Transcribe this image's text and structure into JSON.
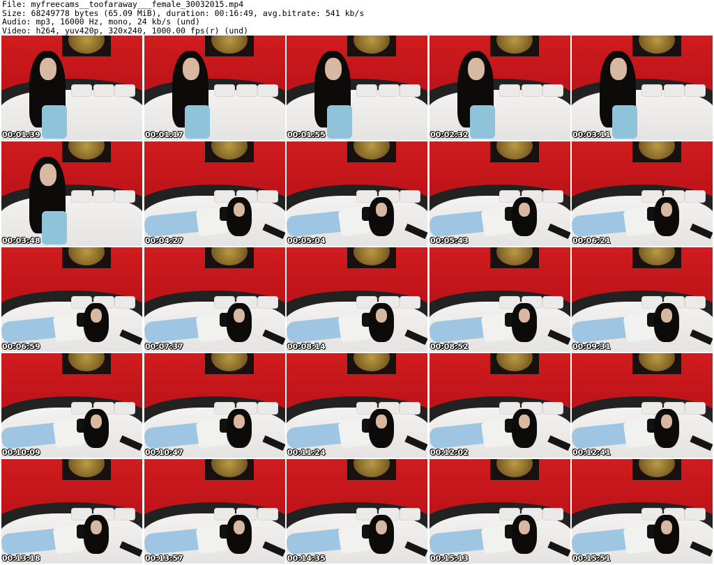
{
  "header": {
    "line1": "File: myfreecams__toofaraway___female_30032015.mp4",
    "line2": "Size: 68249778 bytes (65.09 MiB), duration: 00:16:49, avg.bitrate: 541 kb/s",
    "line3": "Audio: mp3, 16000 Hz, mono, 24 kb/s (und)",
    "line4": "Video: h264, yuv420p, 320x240, 1000.00 fps(r) (und)"
  },
  "thumbnails": [
    {
      "time": "00:01:39",
      "pose": "sit"
    },
    {
      "time": "00:01:17",
      "pose": "sit"
    },
    {
      "time": "00:01:55",
      "pose": "sit"
    },
    {
      "time": "00:02:32",
      "pose": "sit"
    },
    {
      "time": "00:03:11",
      "pose": "sit"
    },
    {
      "time": "00:03:48",
      "pose": "sit"
    },
    {
      "time": "00:04:27",
      "pose": "lie"
    },
    {
      "time": "00:05:04",
      "pose": "lie"
    },
    {
      "time": "00:05:43",
      "pose": "lie"
    },
    {
      "time": "00:06:21",
      "pose": "lie"
    },
    {
      "time": "00:06:59",
      "pose": "lie"
    },
    {
      "time": "00:07:37",
      "pose": "lie"
    },
    {
      "time": "00:08:14",
      "pose": "lie"
    },
    {
      "time": "00:08:52",
      "pose": "lie"
    },
    {
      "time": "00:09:31",
      "pose": "lie"
    },
    {
      "time": "00:10:09",
      "pose": "lie"
    },
    {
      "time": "00:10:47",
      "pose": "lie"
    },
    {
      "time": "00:11:24",
      "pose": "lie"
    },
    {
      "time": "00:12:02",
      "pose": "lie"
    },
    {
      "time": "00:12:41",
      "pose": "lie"
    },
    {
      "time": "00:13:18",
      "pose": "lie"
    },
    {
      "time": "00:13:57",
      "pose": "lie"
    },
    {
      "time": "00:14:35",
      "pose": "lie"
    },
    {
      "time": "00:15:13",
      "pose": "lie"
    },
    {
      "time": "00:15:51",
      "pose": "lie"
    }
  ]
}
